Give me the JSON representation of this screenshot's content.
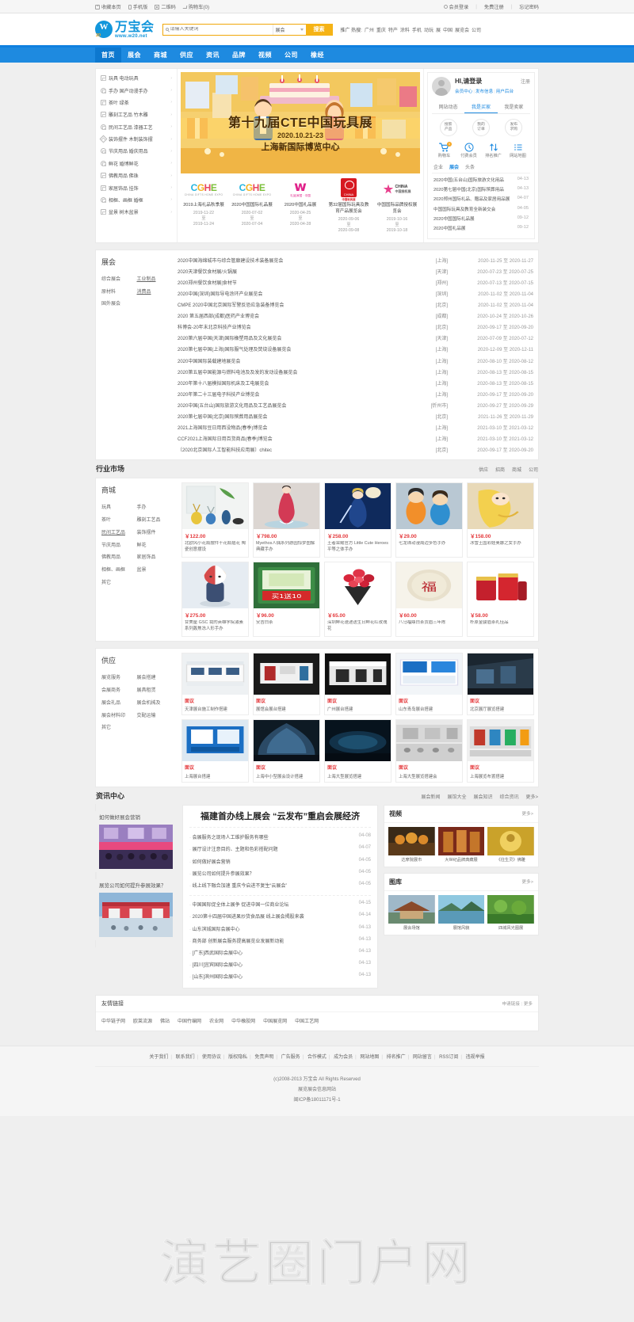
{
  "topbar": {
    "left": [
      {
        "icon": "bookmark-icon",
        "label": "收藏本页"
      },
      {
        "icon": "mobile-icon",
        "label": "手机版"
      },
      {
        "icon": "qrcode-icon",
        "label": "二维码"
      },
      {
        "icon": "cart-icon",
        "label": "购物车(0)"
      }
    ],
    "right": [
      {
        "icon": "user-icon",
        "label": "会员登录"
      },
      {
        "icon": "",
        "label": "免费注册"
      },
      {
        "icon": "",
        "label": "忘记密码"
      }
    ]
  },
  "header": {
    "logo_cn": "万宝会",
    "logo_en": "www.w20.net",
    "logo_w": "W",
    "logo_num": "20",
    "search": {
      "placeholder": "请输入关键词",
      "category": "展会",
      "button": "搜索"
    },
    "hot_label": "推广 热搜:",
    "hot_words": [
      "广州",
      "重庆",
      "特产",
      "涂料",
      "手机",
      "动玩",
      "展",
      "中国",
      "展览会",
      "公司"
    ]
  },
  "nav": [
    {
      "label": "首页",
      "active": true
    },
    {
      "label": "展会",
      "active": false
    },
    {
      "label": "商城",
      "active": false
    },
    {
      "label": "供应",
      "active": false
    },
    {
      "label": "资讯",
      "active": false
    },
    {
      "label": "品牌",
      "active": false
    },
    {
      "label": "视频",
      "active": false
    },
    {
      "label": "公司",
      "active": false
    },
    {
      "label": "橡经",
      "active": false
    }
  ],
  "categories": [
    {
      "icon": "toy-icon",
      "label": "玩具 电动玩具"
    },
    {
      "icon": "figure-icon",
      "label": "手办 国产动漫手办"
    },
    {
      "icon": "tea-icon",
      "label": "茶叶 绿茶"
    },
    {
      "icon": "carving-icon",
      "label": "雕刻工艺品 竹木雕"
    },
    {
      "icon": "folkcraft-icon",
      "label": "民间工艺品 漆器工艺"
    },
    {
      "icon": "decor-icon",
      "label": "装饰摆件 木制装饰摆"
    },
    {
      "icon": "festival-icon",
      "label": "节庆用品 婚庆用品"
    },
    {
      "icon": "flower-icon",
      "label": "鲜花 婚博鲜花"
    },
    {
      "icon": "buddhism-icon",
      "label": "佛教用品 佛珠"
    },
    {
      "icon": "home-decor-icon",
      "label": "家居饰品 挂饰"
    },
    {
      "icon": "frame-icon",
      "label": "相框、画框 婚框"
    },
    {
      "icon": "bonsai-icon",
      "label": "盆景 树木盆景"
    }
  ],
  "banner": {
    "title": "第十九届CTE中国玩具展",
    "date": "2020.10.21-23",
    "venue": "上海新国际博览中心"
  },
  "expo_logos": [
    {
      "logo": "cgme-logo",
      "name": "2019上海礼品秋季展",
      "date_from": "2019-11-22",
      "date_to": "2019-11-24"
    },
    {
      "logo": "cgme-logo",
      "name": "2020中国国际礼品展",
      "date_from": "2020-07-02",
      "date_to": "2020-07-04"
    },
    {
      "logo": "gift-home-logo",
      "name": "2020中国礼品展",
      "date_from": "2020-04-25",
      "date_to": "2020-04-28"
    },
    {
      "logo": "toy-expo-logo",
      "name": "第32届国际玩具及教育产品展览会",
      "date_from": "2020-09-06",
      "date_to": "2020-09-08"
    },
    {
      "logo": "china-brand-logo",
      "name": "中国国际品牌授权展览会",
      "date_from": "2019-10-16",
      "date_to": "2019-10-18"
    }
  ],
  "userbox": {
    "greeting": "HI,请登录",
    "register": "注册",
    "links": [
      "会员中心",
      "发布信息",
      "用户后台"
    ],
    "tabs": [
      {
        "label": "网站动态",
        "active": false
      },
      {
        "label": "我是买家",
        "active": true
      },
      {
        "label": "我是卖家",
        "active": false
      }
    ],
    "circles": [
      {
        "line1": "搜索",
        "line2": "产品"
      },
      {
        "line1": "我的",
        "line2": "订单"
      },
      {
        "line1": "发布",
        "line2": "求购"
      }
    ],
    "quick": [
      {
        "icon": "cart-icon",
        "glyph": "🛒",
        "label": "购物车",
        "badge": "0"
      },
      {
        "icon": "clock-icon",
        "glyph": "◷",
        "label": "付费会员",
        "badge": ""
      },
      {
        "icon": "rank-icon",
        "glyph": "⇅",
        "label": "排名推广",
        "badge": ""
      },
      {
        "icon": "sitemap-icon",
        "glyph": "☰",
        "label": "网站地图",
        "badge": ""
      }
    ]
  },
  "news_tabs": [
    {
      "label": "企业",
      "active": false
    },
    {
      "label": "展会",
      "active": true
    },
    {
      "label": "头条",
      "active": false
    }
  ],
  "news_side": [
    {
      "title": "2020中国(五台山)国际旅游文化用品",
      "date": "04-13"
    },
    {
      "title": "2020第七届中国(北京)国际殡葬用品",
      "date": "04-13"
    },
    {
      "title": "2020郑州国际礼品、赠品及家居用品展",
      "date": "04-07"
    },
    {
      "title": "中国国际玩具及教育全新装交会",
      "date": "04-05"
    },
    {
      "title": "2020中国国际礼品展",
      "date": "09-12"
    },
    {
      "title": "2020中国礼品展",
      "date": "09-12"
    }
  ],
  "exhibition": {
    "title": "展会",
    "tags": [
      "综合展会",
      "工业制品",
      "原材料",
      "消费品",
      "国外展会"
    ],
    "underlined": [
      "工业制品",
      "消费品"
    ],
    "rows": [
      {
        "title": "2020中国海绵城市与综合管廊建设技术装备展览会",
        "city": "[上海]",
        "date": "2020-11-25 至 2020-11-27"
      },
      {
        "title": "2020天津餐饮食材展/火锅展",
        "city": "[天津]",
        "date": "2020-07-23 至 2020-07-25"
      },
      {
        "title": "2020郑州餐饮食材展|食材节",
        "city": "[郑州]",
        "date": "2020-07-13 至 2020-07-15"
      },
      {
        "title": "2020中国(深圳)国际导电涂环产业展览会",
        "city": "[深圳]",
        "date": "2020-11-02 至 2020-11-04"
      },
      {
        "title": "CMPE 2020中国北京国际军警反恐应急装备博览会",
        "city": "[北京]",
        "date": "2020-11-02 至 2020-11-04"
      },
      {
        "title": "2020 第五届西部(成都)医药产业博览会",
        "city": "[成都]",
        "date": "2020-10-24 至 2020-10-26"
      },
      {
        "title": "科博会-20年末北京科技产业博览会",
        "city": "[北京]",
        "date": "2020-09-17 至 2020-09-20"
      },
      {
        "title": "2020第六届中国(天津)国际橡塑用品及文化展览会",
        "city": "[天津]",
        "date": "2020-07-09 至 2020-07-12"
      },
      {
        "title": "2020第七届中国(上海)国际服气处理及焚烧设备展览会",
        "city": "[上海]",
        "date": "2020-12-09 至 2020-12-11"
      },
      {
        "title": "2020中国国际装载建地展览会",
        "city": "[上海]",
        "date": "2020-08-10 至 2020-08-12"
      },
      {
        "title": "2020第五届中国能源与燃料电池及及发的发动设备展览会",
        "city": "[上海]",
        "date": "2020-08-13 至 2020-08-15"
      },
      {
        "title": "2020年第十八届模拟国际机床及工电展览会",
        "city": "[上海]",
        "date": "2020-08-13 至 2020-08-15"
      },
      {
        "title": "2020年第二十三届电子科技产业博览会",
        "city": "[上海]",
        "date": "2020-09-17 至 2020-09-20"
      },
      {
        "title": "2020中国(五台山)国际旅游文化用品及工艺品展览会",
        "city": "[忻州市]",
        "date": "2020-09-27 至 2020-09-29"
      },
      {
        "title": "2020第七届中国(北京)国际殡葬用品展览会",
        "city": "[北京]",
        "date": "2021-11-26 至 2020-11-29"
      },
      {
        "title": "2021上海国际豆日用西没物品(春季)博览会",
        "city": "[上海]",
        "date": "2021-03-10 至 2021-03-12"
      },
      {
        "title": "CCF2021上海国际日用百货商品(春季)博览会",
        "city": "[上海]",
        "date": "2021-03-10 至 2021-03-12"
      },
      {
        "title": "〔2020北京国际人工智能科技应用展〕chitec",
        "city": "[北京]",
        "date": "2020-09-17 至 2020-09-20"
      }
    ]
  },
  "market": {
    "section_title": "行业市场",
    "section_links": [
      "供应",
      "招商",
      "商城",
      "公司"
    ],
    "title": "商城",
    "tags": [
      "玩具",
      "手办",
      "茶叶",
      "雕刻工艺品",
      "民间工艺品",
      "装饰摆件",
      "节庆用品",
      "鲜花",
      "佛教用品",
      "家居饰品",
      "相框、画框",
      "盆景",
      "其它"
    ],
    "underlined": [
      "民间工艺品"
    ],
    "products": [
      {
        "price": "￥122.00",
        "name": "北欧风小花瓶摆件干花瓶插花 陶瓷创意摆设",
        "img": "vase-photo"
      },
      {
        "price": "￥798.00",
        "name": "Myethos人偶系列游园惊梦图解典藏手办",
        "img": "figurine-photo"
      },
      {
        "price": "￥258.00",
        "name": "王者荣耀官方 Little Cute Heroes平等之体手办",
        "img": "anime-photo"
      },
      {
        "price": "￥29.00",
        "name": "七龙珠动漫周边多色手办",
        "img": "dragonball-photo"
      },
      {
        "price": "￥158.00",
        "name": "冰雪王国彩娃奥娜之女手办",
        "img": "blonde-figure-photo"
      },
      {
        "price": "￥275.00",
        "name": "甘美屋 GSC 我的英雄学院激素系列轰焦冻人形手办",
        "img": "mha-photo"
      },
      {
        "price": "￥96.00",
        "name": "安吉白茶",
        "img": "tea-photo"
      },
      {
        "price": "￥65.00",
        "name": "深圳鲜花速递送生日鲜花红玫瑰花",
        "img": "bouquet-photo"
      },
      {
        "price": "￥60.00",
        "name": "八马福鼎白茶贡眉三年陈",
        "img": "teacake-photo"
      },
      {
        "price": "￥58.00",
        "name": "朴原金骏眉茶礼佳品",
        "img": "redbox-photo"
      }
    ]
  },
  "supply": {
    "title": "供应",
    "tags": [
      "展览服务",
      "展会搭建",
      "会展商务",
      "展具租赁",
      "展会礼品",
      "展会机械及",
      "展会材料印",
      "交配运输",
      "其它"
    ],
    "items": [
      {
        "price": "面议",
        "name": "天津展台施工制作搭建",
        "img": "booth-white-photo"
      },
      {
        "price": "面议",
        "name": "展馆会展台搭建",
        "img": "booth-dark-photo"
      },
      {
        "price": "面议",
        "name": "广州展台搭建",
        "img": "booth-exterior-photo"
      },
      {
        "price": "面议",
        "name": "山东青岛展台搭建",
        "img": "booth-blue-photo"
      },
      {
        "price": "面议",
        "name": "北京展厅展览搭建",
        "img": "booth-hall-photo"
      },
      {
        "price": "面议",
        "name": "上海展台搭建",
        "img": "booth-shanghai-photo"
      },
      {
        "price": "面议",
        "name": "上海中小型展会设计搭建",
        "img": "booth-tent-photo"
      },
      {
        "price": "面议",
        "name": "上海大型展览搭建",
        "img": "booth-large-photo"
      },
      {
        "price": "面议",
        "name": "上海大型展览搭建会",
        "img": "booth-crowd-photo"
      },
      {
        "price": "面议",
        "name": "上海展览布置搭建",
        "img": "booth-display-photo"
      }
    ]
  },
  "newscenter": {
    "section_title": "资讯中心",
    "section_links": [
      "展会新闻",
      "展馆大全",
      "展会知识",
      "综合资讯",
      "更多>"
    ],
    "promos": [
      {
        "title": "如何做好展会营销",
        "img": "conference-photo"
      },
      {
        "title": "展览公司如何提升参展效果？",
        "img": "expo-entrance-photo"
      }
    ],
    "feature": "福建首办线上展会 “云发布”重启会展经济",
    "list_top": [
      {
        "title": "会展服务之现场人工维护服务有哪些",
        "date": "04-08"
      },
      {
        "title": "展厅设计注意目的、主题和色彩搭配问题",
        "date": "04-07"
      },
      {
        "title": "如何做好展会营销",
        "date": "04-05"
      },
      {
        "title": "展览公司如何提升参展效果？",
        "date": "04-05"
      },
      {
        "title": "线上线下融合加速 重庆今启进不复生“云展会”",
        "date": "04-05"
      }
    ],
    "list_bottom": [
      {
        "title": "中国国际促全体上展争 促进中国一位商业论坛",
        "date": "04-15"
      },
      {
        "title": "2020第十四届中国进果炒货食品展 线上展会揭股来袭",
        "date": "04-14"
      },
      {
        "title": "山东滨城国际会展中心",
        "date": "04-13"
      },
      {
        "title": "商务部 创新展会服务提高展览业发展新动能",
        "date": "04-13"
      },
      {
        "title": "[广东]西武国际会展中心",
        "date": "04-13"
      },
      {
        "title": "[四川]宜宾国际会展中心",
        "date": "04-13"
      },
      {
        "title": "[山东]滨州国际会展中心",
        "date": "04-13"
      }
    ],
    "video": {
      "title": "视频",
      "more": "更多>",
      "items": [
        {
          "name": "达摩院展市",
          "img": "monk-video"
        },
        {
          "name": "大世纪品牌典藏展",
          "img": "buddha-video"
        },
        {
          "name": "《往生灵》佛雕",
          "img": "gold-video"
        }
      ]
    },
    "gallery": {
      "title": "图库",
      "more": "更多>",
      "items": [
        {
          "name": "展会场馆",
          "img": "temple-photo"
        },
        {
          "name": "展馆风貌",
          "img": "lake-photo"
        },
        {
          "name": "四城风光图展",
          "img": "green-photo"
        }
      ]
    }
  },
  "friendlinks": {
    "title": "友情链接",
    "apply": "申请链接",
    "more": "更多",
    "items": [
      "中华链子网",
      "欧莱流源",
      "佛站",
      "中国竹编网",
      "农业网",
      "中华橡胶网",
      "中国展览网",
      "中国工艺网"
    ]
  },
  "footer": {
    "nav": [
      "关于我们",
      "联系我们",
      "使用协议",
      "版权隐私",
      "免责声明",
      "广告服务",
      "合作模式",
      "成为会员",
      "网站地图",
      "排名推广",
      "网站留言",
      "RSS订阅",
      "违规举报"
    ],
    "copyright": "(c)2008-2013 万宝会 All Rights Reserved",
    "tagline": "展览展会信息网站",
    "icp": "闽ICP备18011171号-1"
  },
  "watermark": "演艺圈门户网",
  "colors": {
    "brand_blue": "#1e8ae0",
    "nav_blue": "#1e8ae0",
    "accent_orange": "#f5b316",
    "price_red": "#e4393c"
  }
}
